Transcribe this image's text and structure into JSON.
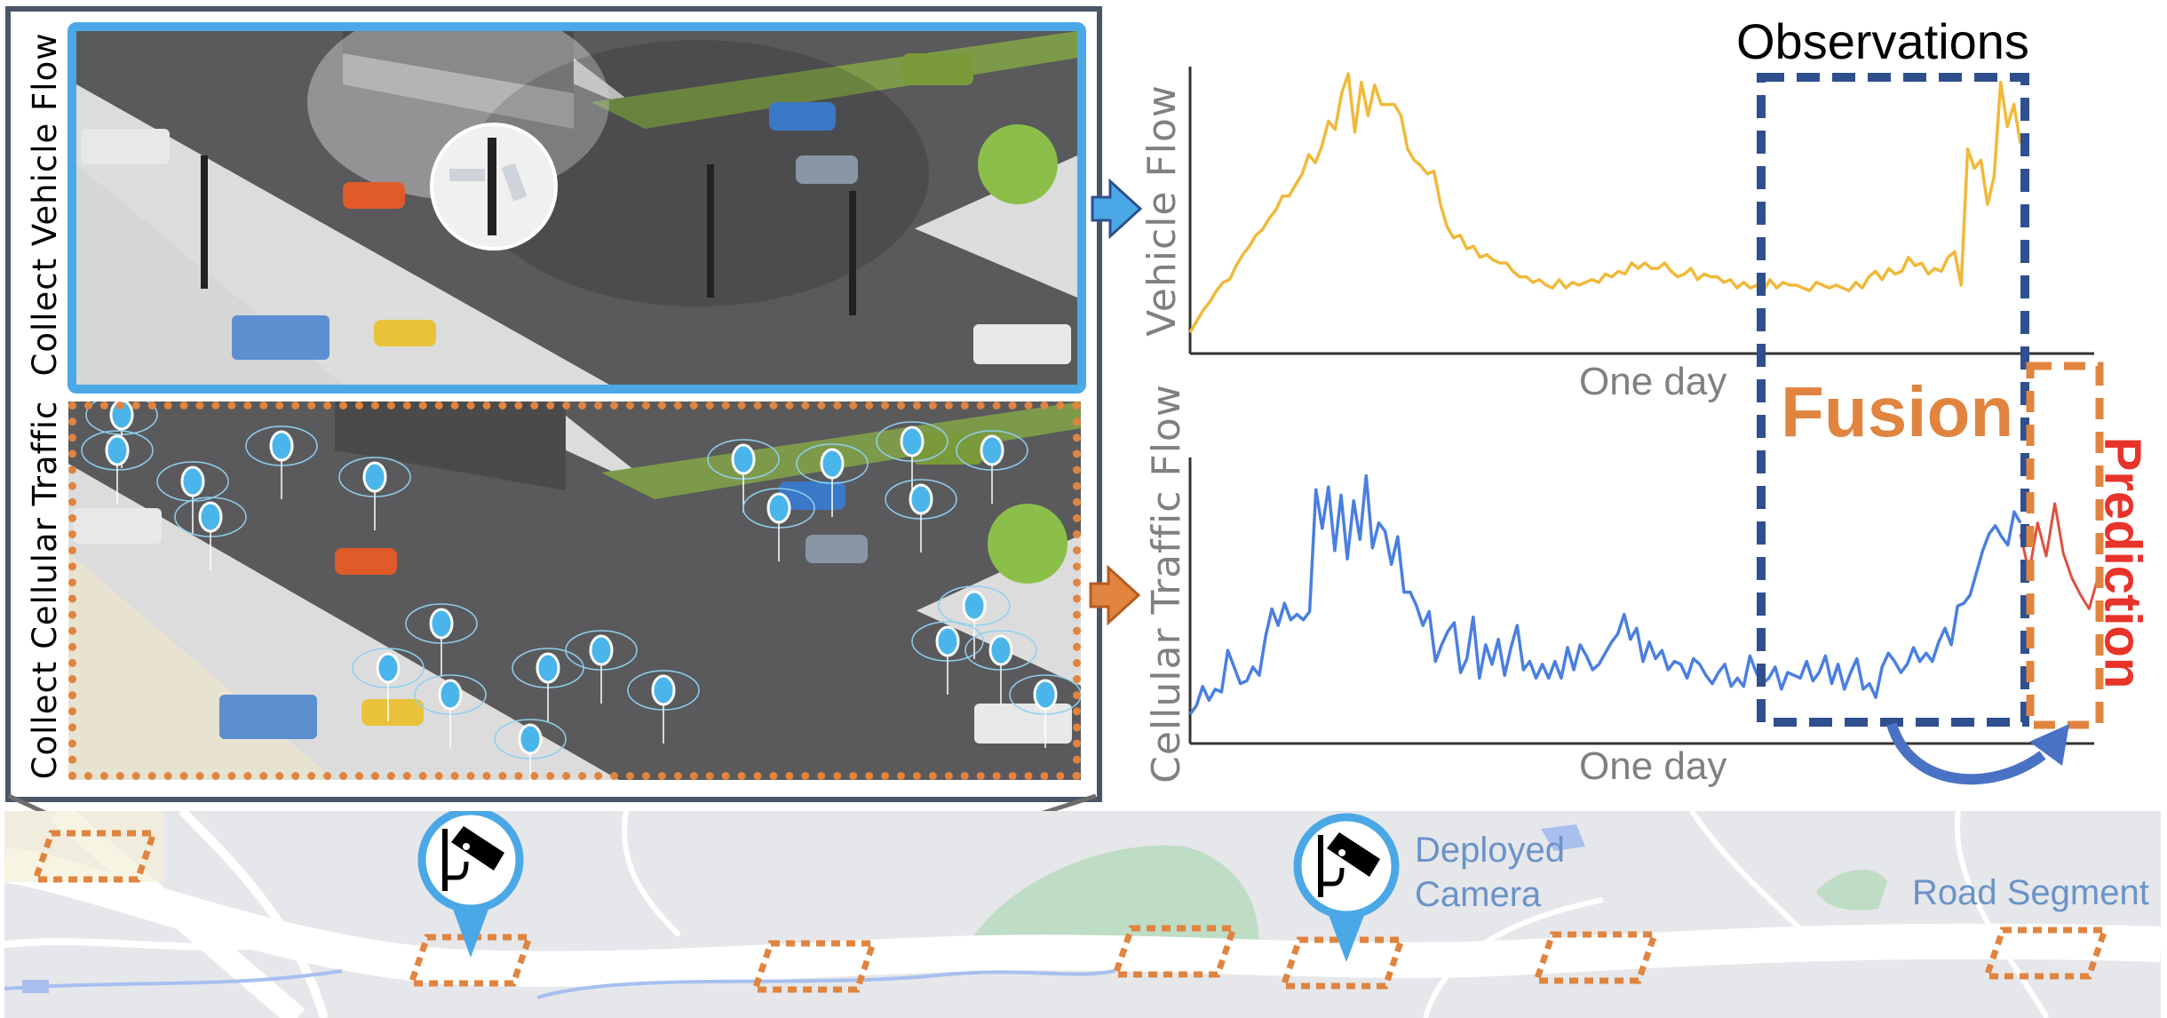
{
  "panels": {
    "vehicle": {
      "label": "Collect Vehicle Flow",
      "border_color": "#4ba8e6"
    },
    "cellular": {
      "label": "Collect Cellular Traffic",
      "border_color": "#e0843f"
    }
  },
  "arrows": {
    "vehicle_arrow_color": "#4ba8e6",
    "cellular_arrow_color": "#e0843f"
  },
  "annotations": {
    "observations": "Observations",
    "fusion": "Fusion",
    "prediction": "Prediction",
    "observations_box_color": "#2f4f8f",
    "prediction_box_color": "#e0843f",
    "prediction_color": "#e8332a",
    "fusion_color": "#e0843f"
  },
  "map": {
    "camera_label_line1": "Deployed",
    "camera_label_line2": "Camera",
    "segment_label": "Road Segment",
    "camera_pin_count": 2,
    "road_segment_count": 8,
    "pin_color": "#4ba8e6",
    "segment_color": "#e0843f"
  },
  "chart_data": [
    {
      "type": "line",
      "title": "",
      "xlabel": "One day",
      "ylabel": "Vehicle Flow",
      "grid": false,
      "ylim": [
        0,
        1
      ],
      "series": [
        {
          "name": "Vehicle Flow",
          "color": "#f0b93a",
          "values": [
            0.06,
            0.1,
            0.14,
            0.17,
            0.21,
            0.24,
            0.25,
            0.3,
            0.34,
            0.37,
            0.41,
            0.43,
            0.47,
            0.5,
            0.55,
            0.55,
            0.59,
            0.63,
            0.7,
            0.67,
            0.73,
            0.82,
            0.79,
            0.92,
            0.99,
            0.78,
            0.96,
            0.84,
            0.95,
            0.88,
            0.88,
            0.88,
            0.84,
            0.72,
            0.68,
            0.66,
            0.63,
            0.64,
            0.52,
            0.44,
            0.4,
            0.41,
            0.36,
            0.37,
            0.33,
            0.34,
            0.32,
            0.31,
            0.31,
            0.28,
            0.26,
            0.26,
            0.24,
            0.25,
            0.23,
            0.22,
            0.25,
            0.22,
            0.24,
            0.23,
            0.24,
            0.25,
            0.24,
            0.27,
            0.26,
            0.28,
            0.27,
            0.31,
            0.29,
            0.31,
            0.29,
            0.29,
            0.31,
            0.28,
            0.26,
            0.27,
            0.29,
            0.25,
            0.27,
            0.26,
            0.26,
            0.24,
            0.25,
            0.22,
            0.24,
            0.22,
            0.23,
            0.21,
            0.25,
            0.22,
            0.24,
            0.23,
            0.23,
            0.22,
            0.21,
            0.24,
            0.23,
            0.22,
            0.23,
            0.22,
            0.21,
            0.24,
            0.22,
            0.26,
            0.28,
            0.25,
            0.29,
            0.27,
            0.28,
            0.33,
            0.3,
            0.31,
            0.27,
            0.29,
            0.28,
            0.33,
            0.35,
            0.23,
            0.72,
            0.65,
            0.68,
            0.52,
            0.62,
            0.96,
            0.8,
            0.88,
            0.74
          ]
        }
      ],
      "observation_window": [
        0.81,
        0.99
      ]
    },
    {
      "type": "line",
      "title": "",
      "xlabel": "One day",
      "ylabel": "Cellular Traffic Flow",
      "grid": false,
      "ylim": [
        0,
        1
      ],
      "series": [
        {
          "name": "Cellular Traffic Flow",
          "color": "#4a7fe0",
          "values": [
            0.09,
            0.12,
            0.19,
            0.14,
            0.18,
            0.17,
            0.32,
            0.26,
            0.2,
            0.21,
            0.26,
            0.23,
            0.37,
            0.47,
            0.41,
            0.49,
            0.43,
            0.45,
            0.43,
            0.46,
            0.9,
            0.76,
            0.91,
            0.68,
            0.88,
            0.65,
            0.86,
            0.72,
            0.95,
            0.69,
            0.78,
            0.75,
            0.63,
            0.73,
            0.53,
            0.53,
            0.48,
            0.41,
            0.46,
            0.28,
            0.34,
            0.39,
            0.42,
            0.24,
            0.29,
            0.44,
            0.22,
            0.34,
            0.27,
            0.36,
            0.23,
            0.33,
            0.41,
            0.25,
            0.28,
            0.22,
            0.27,
            0.22,
            0.28,
            0.22,
            0.33,
            0.25,
            0.34,
            0.3,
            0.25,
            0.27,
            0.31,
            0.35,
            0.38,
            0.45,
            0.36,
            0.4,
            0.28,
            0.35,
            0.29,
            0.32,
            0.25,
            0.28,
            0.27,
            0.22,
            0.29,
            0.27,
            0.23,
            0.2,
            0.24,
            0.27,
            0.19,
            0.22,
            0.19,
            0.3,
            0.24,
            0.2,
            0.22,
            0.26,
            0.18,
            0.24,
            0.23,
            0.22,
            0.28,
            0.21,
            0.24,
            0.3,
            0.2,
            0.27,
            0.18,
            0.24,
            0.29,
            0.18,
            0.2,
            0.15,
            0.26,
            0.31,
            0.28,
            0.24,
            0.27,
            0.33,
            0.28,
            0.31,
            0.28,
            0.35,
            0.4,
            0.34,
            0.48,
            0.49,
            0.52,
            0.6,
            0.68,
            0.74,
            0.77,
            0.73,
            0.7,
            0.82,
            0.78
          ],
          "observation_window": [
            0.81,
            0.99
          ]
        },
        {
          "name": "Prediction",
          "color": "#e05040",
          "values": [
            0.74,
            0.6,
            0.78,
            0.66,
            0.85,
            0.67,
            0.58,
            0.52,
            0.47,
            0.58
          ]
        }
      ]
    }
  ]
}
